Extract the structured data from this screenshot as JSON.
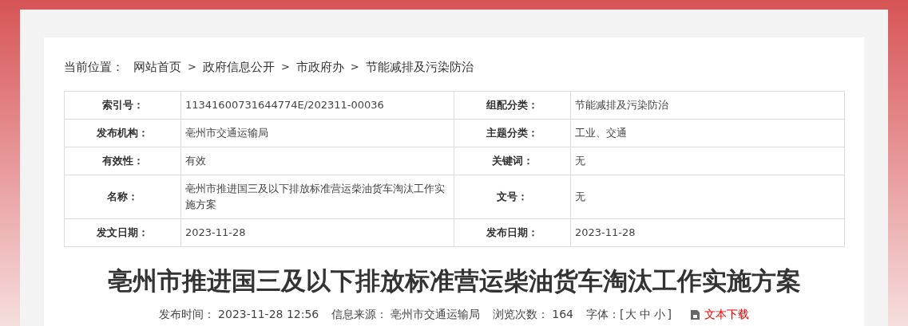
{
  "breadcrumb": {
    "label": "当前位置：",
    "trail": [
      {
        "kind": "link",
        "text": "网站首页"
      },
      {
        "kind": "separator",
        "text": ">"
      },
      {
        "kind": "link",
        "text": "政府信息公开"
      },
      {
        "kind": "separator",
        "text": ">"
      },
      {
        "kind": "link",
        "text": "市政府办"
      },
      {
        "kind": "separator",
        "text": ">"
      },
      {
        "kind": "link",
        "text": "节能减排及污染防治"
      }
    ]
  },
  "info_table": {
    "rows": [
      {
        "cells": [
          {
            "label": "索引号：",
            "value": "11341600731644774E/202311-00036"
          },
          {
            "label": "组配分类：",
            "value": "节能减排及污染防治"
          }
        ]
      },
      {
        "cells": [
          {
            "label": "发布机构：",
            "value": "亳州市交通运输局"
          },
          {
            "label": "主题分类：",
            "value": "工业、交通"
          }
        ]
      },
      {
        "cells": [
          {
            "label": "有效性：",
            "value": "有效"
          },
          {
            "label": "关键词：",
            "value": "无"
          }
        ]
      },
      {
        "cells": [
          {
            "label": "名称：",
            "value": "亳州市推进国三及以下排放标准营运柴油货车淘汰工作实施方案"
          },
          {
            "label": "文号：",
            "value": "无"
          }
        ]
      },
      {
        "cells": [
          {
            "label": "发文日期：",
            "value": "2023-11-28"
          },
          {
            "label": "发布日期：",
            "value": "2023-11-28"
          }
        ]
      }
    ]
  },
  "article": {
    "title": "亳州市推进国三及以下排放标准营运柴油货车淘汰工作实施方案",
    "meta": [
      {
        "label": "发布时间：",
        "value": "2023-11-28 12:56"
      },
      {
        "label": "信息来源：",
        "value": "亳州市交通运输局"
      },
      {
        "label": "浏览次数：",
        "value": "164"
      }
    ],
    "font_size": {
      "label": "字体：",
      "open": "[",
      "options": [
        "大",
        "中",
        "小"
      ],
      "close": "]"
    },
    "download": "文本下载"
  }
}
